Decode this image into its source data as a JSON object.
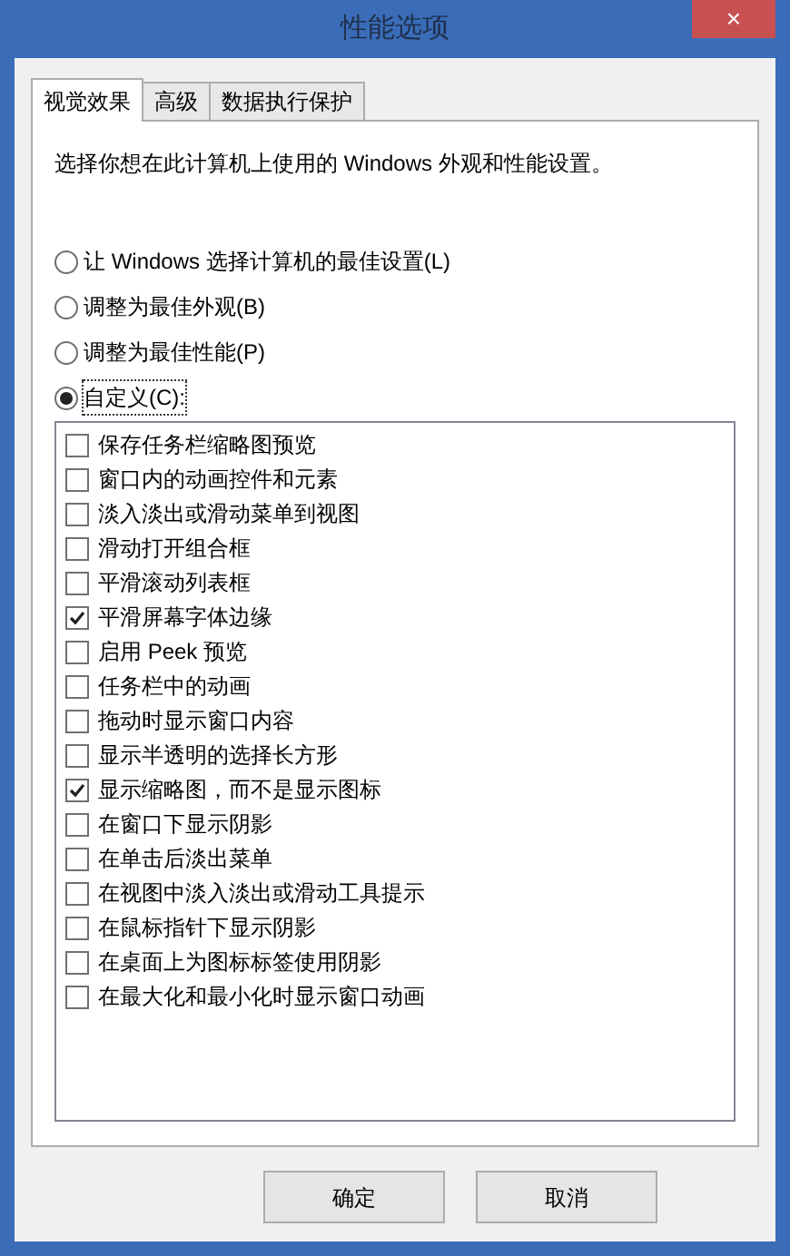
{
  "window": {
    "title": "性能选项",
    "close": "×"
  },
  "tabs": [
    {
      "label": "视觉效果",
      "selected": true
    },
    {
      "label": "高级",
      "selected": false
    },
    {
      "label": "数据执行保护",
      "selected": false
    }
  ],
  "description": "选择你想在此计算机上使用的 Windows 外观和性能设置。",
  "options": [
    {
      "label": "让 Windows 选择计算机的最佳设置(L)",
      "selected": false
    },
    {
      "label": "调整为最佳外观(B)",
      "selected": false
    },
    {
      "label": "调整为最佳性能(P)",
      "selected": false
    },
    {
      "label": "自定义(C):",
      "selected": true
    }
  ],
  "effects": [
    {
      "label": "保存任务栏缩略图预览",
      "checked": false
    },
    {
      "label": "窗口内的动画控件和元素",
      "checked": false
    },
    {
      "label": "淡入淡出或滑动菜单到视图",
      "checked": false
    },
    {
      "label": "滑动打开组合框",
      "checked": false
    },
    {
      "label": "平滑滚动列表框",
      "checked": false
    },
    {
      "label": "平滑屏幕字体边缘",
      "checked": true
    },
    {
      "label": "启用 Peek 预览",
      "checked": false
    },
    {
      "label": "任务栏中的动画",
      "checked": false
    },
    {
      "label": "拖动时显示窗口内容",
      "checked": false
    },
    {
      "label": "显示半透明的选择长方形",
      "checked": false
    },
    {
      "label": "显示缩略图，而不是显示图标",
      "checked": true
    },
    {
      "label": "在窗口下显示阴影",
      "checked": false
    },
    {
      "label": "在单击后淡出菜单",
      "checked": false
    },
    {
      "label": "在视图中淡入淡出或滑动工具提示",
      "checked": false
    },
    {
      "label": "在鼠标指针下显示阴影",
      "checked": false
    },
    {
      "label": "在桌面上为图标标签使用阴影",
      "checked": false
    },
    {
      "label": "在最大化和最小化时显示窗口动画",
      "checked": false
    }
  ],
  "buttons": [
    "确定",
    "取消"
  ]
}
